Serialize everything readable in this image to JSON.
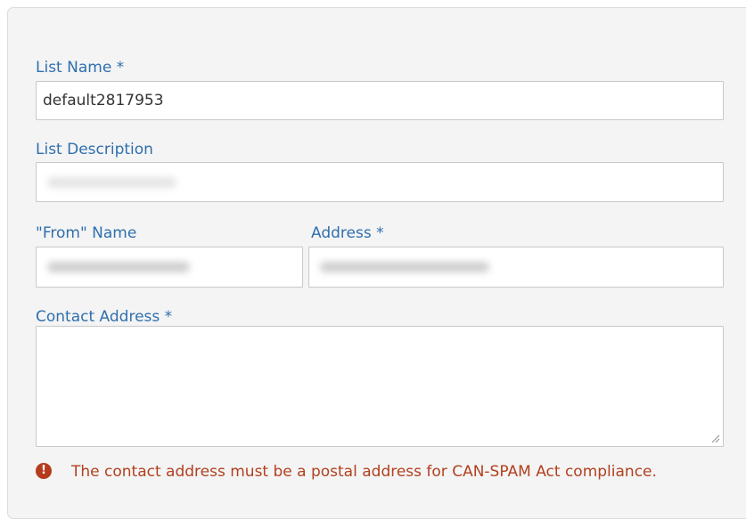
{
  "form": {
    "list_name": {
      "label": "List Name *",
      "value": "default2817953"
    },
    "list_description": {
      "label": "List Description",
      "value": ""
    },
    "from_name": {
      "label": "\"From\" Name",
      "value": ""
    },
    "from_address": {
      "label": "Address *",
      "value": ""
    },
    "contact_address": {
      "label": "Contact Address *",
      "value": ""
    },
    "error": {
      "icon": "exclamation-circle-icon",
      "message": "The contact address must be a postal address for CAN-SPAM Act compliance."
    }
  },
  "colors": {
    "label": "#2f6fae",
    "error": "#b2401f",
    "panel_background": "#f4f4f4"
  }
}
